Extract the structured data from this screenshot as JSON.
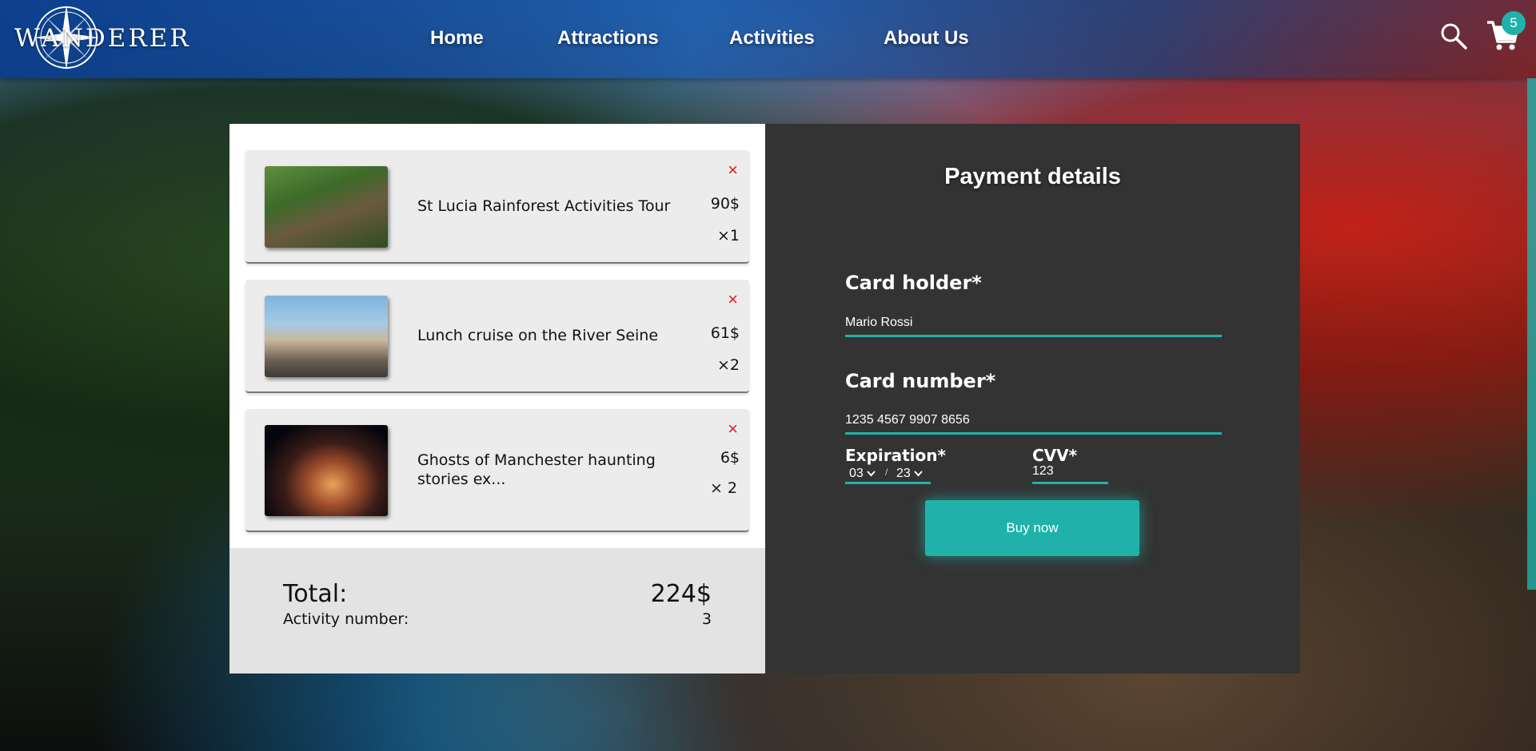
{
  "header": {
    "logo_text": "WANDERER",
    "nav": [
      "Home",
      "Attractions",
      "Activities",
      "About Us"
    ],
    "cart_count": "5"
  },
  "cart": {
    "items": [
      {
        "title": "St Lucia Rainforest Activities Tour",
        "price": "90$",
        "qty": "×1",
        "remove": "×"
      },
      {
        "title": "Lunch cruise on the River Seine",
        "price": "61$",
        "qty": "×2",
        "remove": "×"
      },
      {
        "title": "Ghosts of Manchester haunting stories ex...",
        "price": "6$",
        "qty": "× 2",
        "remove": "×"
      }
    ],
    "total_label": "Total:",
    "total_value": "224$",
    "count_label": "Activity number:",
    "count_value": "3"
  },
  "payment": {
    "title": "Payment details",
    "holder_label": "Card holder*",
    "holder_value": "Mario Rossi",
    "number_label": "Card number*",
    "number_value": "1235 4567 9907 8656",
    "expiration_label": "Expiration*",
    "exp_month": "03",
    "exp_year": "23",
    "exp_sep": "/",
    "cvv_label": "CVV*",
    "cvv_value": "123",
    "buy_label": "Buy now"
  },
  "colors": {
    "accent": "#20b2aa",
    "remove": "#e41b1b",
    "panel_dark": "#333333",
    "panel_light": "#e3e3e3"
  },
  "icons": [
    "compass-logo-icon",
    "search-icon",
    "cart-icon",
    "close-icon",
    "chevron-down-icon"
  ]
}
